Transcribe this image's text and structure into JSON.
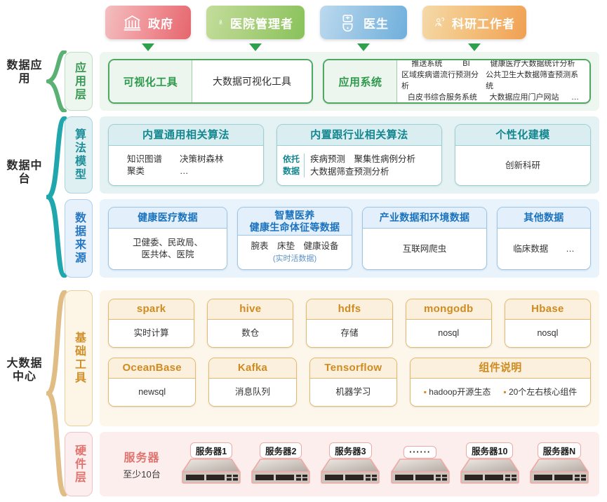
{
  "roles": [
    {
      "label": "政府",
      "icon": "government-bank-icon",
      "color": "#e5666d"
    },
    {
      "label": "医院管理者",
      "icon": "hospital-manager-person-icon",
      "color": "#89c25b"
    },
    {
      "label": "医生",
      "icon": "doctor-icon",
      "color": "#6fafdc"
    },
    {
      "label": "科研工作者",
      "icon": "researcher-icon",
      "color": "#f0a052"
    }
  ],
  "groups": [
    {
      "name": "数据应用",
      "color": "#5ab173"
    },
    {
      "name": "数据中台",
      "color": "#20a7ae"
    },
    {
      "name": "大数据中心",
      "color": "#e0bd84"
    }
  ],
  "layers": {
    "application": {
      "tab": "应用层",
      "cards": [
        {
          "title": "可视化工具",
          "rows": [
            [
              "大数据可视化工具"
            ]
          ]
        },
        {
          "title": "应用系统",
          "rows": [
            [
              "推送系统",
              "BI",
              "健康医疗大数据统计分析"
            ],
            [
              "区域疾病谱流行预测分析",
              "公共卫生大数据筛查预测系统"
            ],
            [
              "白皮书综合服务系统",
              "大数据应用门户网站",
              "…"
            ]
          ]
        }
      ]
    },
    "algorithm": {
      "tab": "算法模型",
      "cards": [
        {
          "title": "内置通用相关算法",
          "key": "",
          "lines": [
            "知识图谱　　决策树森林",
            "聚类　　　　…"
          ]
        },
        {
          "title": "内置跟行业相关算法",
          "key": "依托\n数据",
          "lines": [
            "疾病预测　聚集性病例分析",
            "大数据筛查预测分析"
          ]
        },
        {
          "title": "个性化建模",
          "key": "",
          "lines": [
            "创新科研"
          ]
        }
      ]
    },
    "source": {
      "tab": "数据来源",
      "cards": [
        {
          "title": "健康医疗数据",
          "lines": [
            "卫健委、民政局、",
            "医共体、医院"
          ],
          "note": ""
        },
        {
          "title": "智慧医养\n健康生命体征等数据",
          "lines": [
            "腕表　床垫　健康设备"
          ],
          "note": "(实时活数据)"
        },
        {
          "title": "产业数据和环境数据",
          "lines": [
            "互联网爬虫"
          ],
          "note": ""
        },
        {
          "title": "其他数据",
          "lines": [
            "临床数据　　…"
          ],
          "note": ""
        }
      ]
    },
    "tools": {
      "tab": "基础工具",
      "row1": [
        {
          "name": "spark",
          "desc": "实时计算"
        },
        {
          "name": "hive",
          "desc": "数仓"
        },
        {
          "name": "hdfs",
          "desc": "存储"
        },
        {
          "name": "mongodb",
          "desc": "nosql"
        },
        {
          "name": "Hbase",
          "desc": "nosql"
        }
      ],
      "row2": [
        {
          "name": "OceanBase",
          "desc": "newsql"
        },
        {
          "name": "Kafka",
          "desc": "消息队列"
        },
        {
          "name": "Tensorflow",
          "desc": "机器学习"
        }
      ],
      "note_card": {
        "title": "组件说明",
        "bullets": [
          "hadoop开源生态",
          "20个左右核心组件"
        ]
      }
    },
    "hardware": {
      "tab": "硬件层",
      "title": "服务器",
      "subtitle": "至少10台",
      "servers": [
        "服务器1",
        "服务器2",
        "服务器3",
        "······",
        "服务器10",
        "服务器N"
      ]
    }
  }
}
